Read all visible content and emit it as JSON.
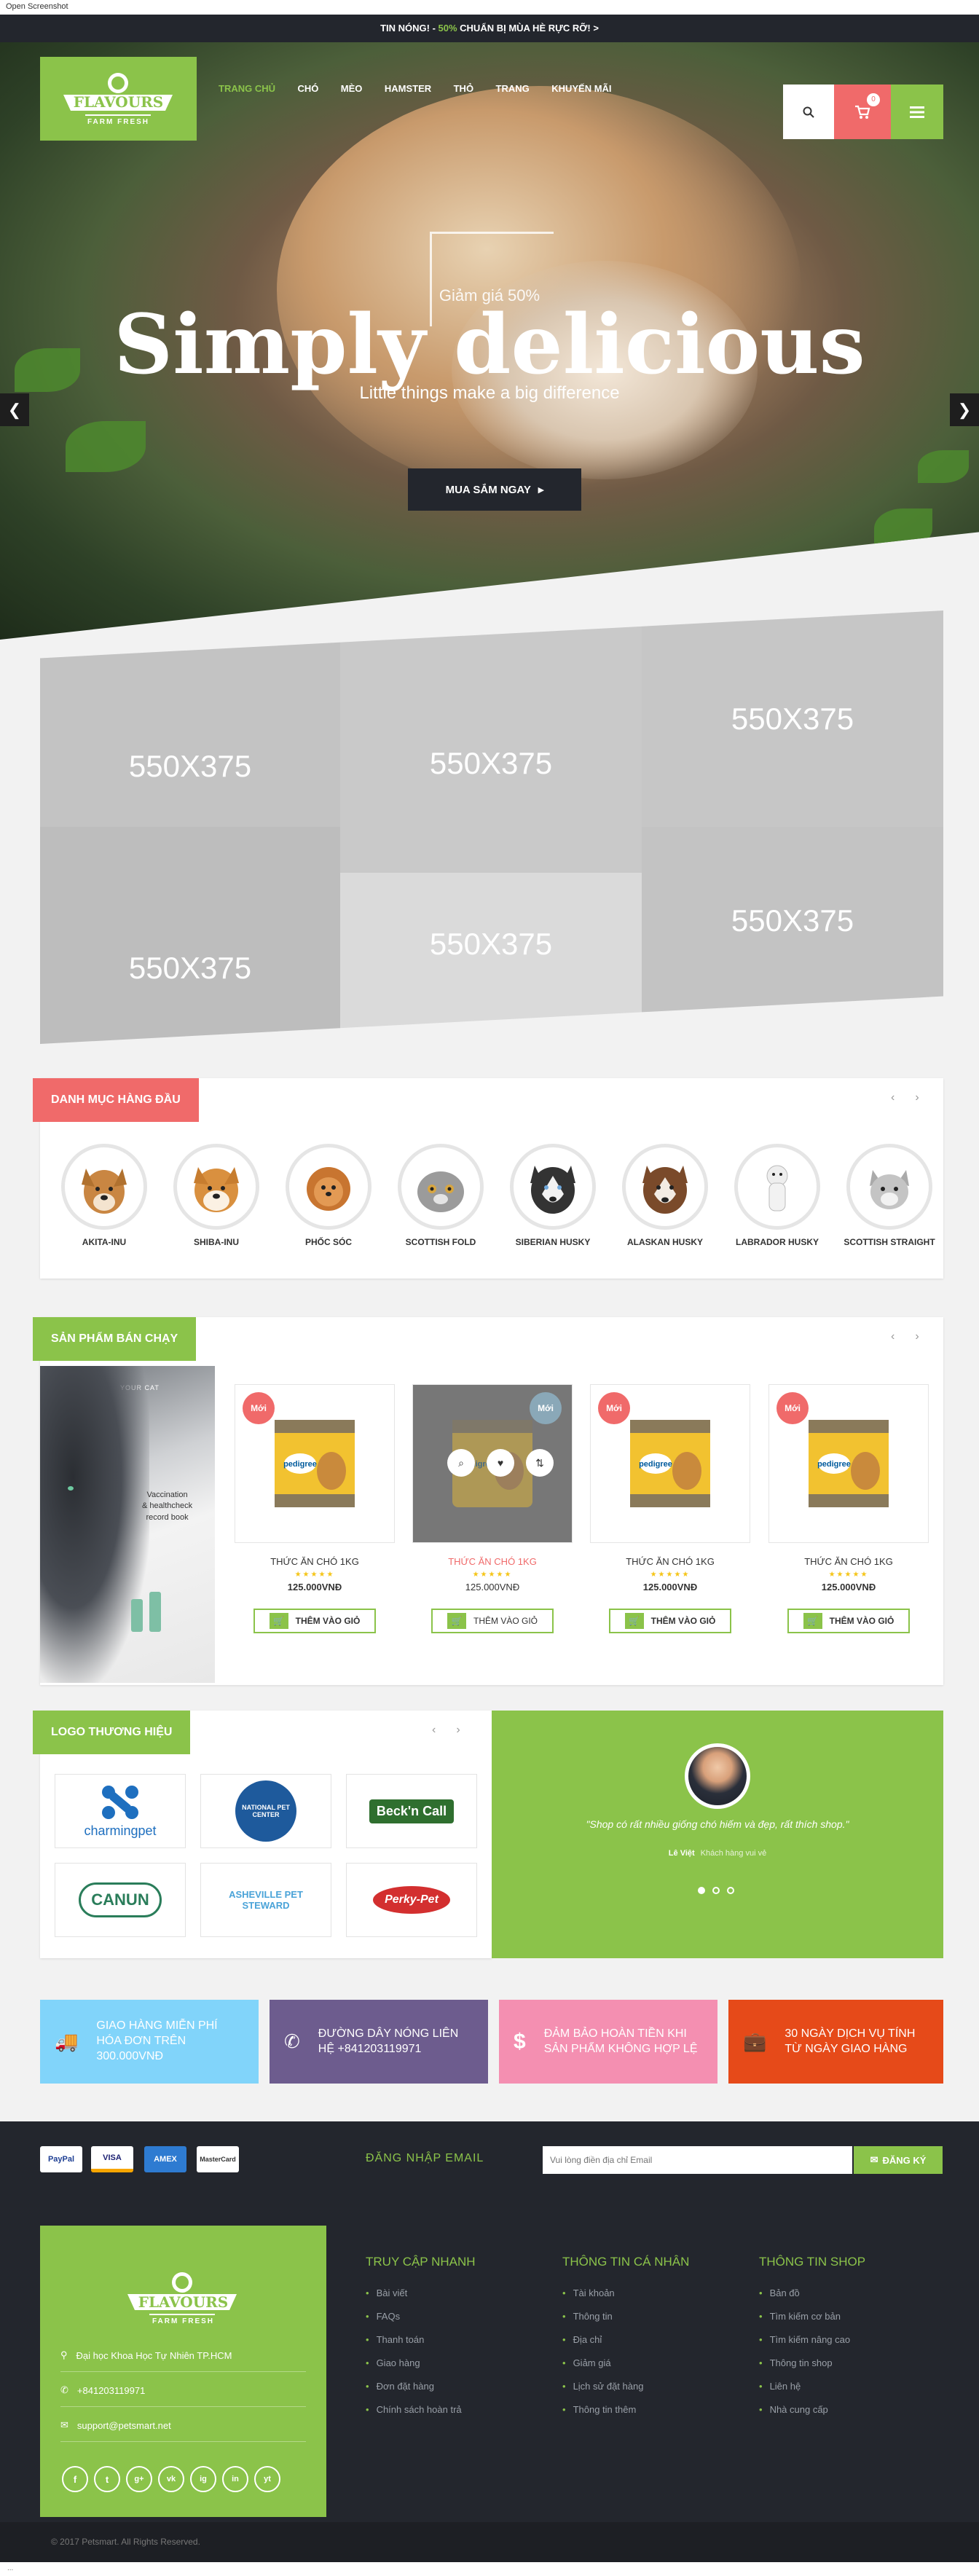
{
  "browser": {
    "label": "Open Screenshot",
    "status": "..."
  },
  "announcement": {
    "prefix": "TIN NÓNG! - ",
    "highlight": "50%",
    "suffix": " CHUẨN BỊ MÙA HÈ RỰC RỠ! >"
  },
  "logo": {
    "name": "FLAVOURS",
    "tagline": "FARM FRESH"
  },
  "nav": [
    "TRANG CHỦ",
    "CHÓ",
    "MÈO",
    "HAMSTER",
    "THỎ",
    "TRANG",
    "KHUYẾN MÃI"
  ],
  "cart": {
    "count": "0"
  },
  "hero": {
    "subtitle": "Giảm giá 50%",
    "title": "Simply delicious",
    "tagline": "Little things make a big difference",
    "cta": "MUA SẮM NGAY",
    "prev": "❮",
    "next": "❯"
  },
  "banners": [
    "550X375",
    "550X375",
    "550X375",
    "550X375",
    "550X375",
    "550X375"
  ],
  "categories": {
    "title": "DANH MỤC HÀNG ĐẦU",
    "prev": "‹",
    "next": "›",
    "items": [
      "AKITA-INU",
      "SHIBA-INU",
      "PHỐC SÓC",
      "SCOTTISH FOLD",
      "SIBERIAN HUSKY",
      "ALASKAN HUSKY",
      "LABRADOR HUSKY",
      "SCOTTISH STRAIGHT"
    ]
  },
  "bestsellers": {
    "title": "SẢN PHẨM BÁN CHẠY",
    "prev": "‹",
    "next": "›",
    "side_image_text": [
      "Vaccination",
      "& healthcheck",
      "record book"
    ],
    "side_image_header": "YOUR CAT",
    "products": [
      {
        "badge": "Mới",
        "name": "THỨC ĂN CHÓ 1KG",
        "price": "125.000VNĐ",
        "button": "THÊM VÀO GIỎ",
        "brand": "pedigree"
      },
      {
        "badge": "Mới",
        "name": "THỨC ĂN CHÓ 1KG",
        "price": "125.000VNĐ",
        "button": "THÊM VÀO GIỎ",
        "brand": "pedigree"
      },
      {
        "badge": "Mới",
        "name": "THỨC ĂN CHÓ 1KG",
        "price": "125.000VNĐ",
        "button": "THÊM VÀO GIỎ",
        "brand": "pedigree"
      },
      {
        "badge": "Mới",
        "name": "THỨC ĂN CHÓ 1KG",
        "price": "125.000VNĐ",
        "button": "THÊM VÀO GIỎ",
        "brand": "pedigree"
      }
    ],
    "rating": "★★★★★"
  },
  "brands": {
    "title": "LOGO THƯƠNG HIỆU",
    "prev": "‹",
    "next": "›",
    "items": [
      "charmingpet",
      "NATIONAL PET CENTER",
      "Beck'n Call",
      "CANUN",
      "ASHEVILLE PET STEWARD",
      "Perky-Pet"
    ]
  },
  "testimonial": {
    "quote": "\"Shop có rất nhiều giống chó hiếm và đẹp, rất thích shop.\"",
    "author": "Lê Việt",
    "role": "Khách hàng vui vẻ"
  },
  "services": [
    {
      "text": "GIAO HÀNG MIỄN PHÍ HÓA ĐƠN TRÊN 300.000VNĐ",
      "color": "#81d4fa",
      "icon": "truck-icon"
    },
    {
      "text": "ĐƯỜNG DÂY NÓNG LIÊN HỆ +841203119971",
      "color": "#6d5c8e",
      "icon": "phone-icon"
    },
    {
      "text": "ĐẢM BẢO HOÀN TIỀN KHI SẢN PHẨM KHÔNG HỢP LỆ",
      "color": "#f48fb1",
      "icon": "dollar-icon"
    },
    {
      "text": "30 NGÀY DỊCH VỤ TÍNH TỪ NGÀY GIAO HÀNG",
      "color": "#e64a19",
      "icon": "briefcase-icon"
    }
  ],
  "payments": [
    "PayPal",
    "VISA",
    "AMEX",
    "MasterCard"
  ],
  "newsletter": {
    "label": "ĐĂNG NHẬP EMAIL",
    "placeholder": "Vui lòng điền địa chỉ Email",
    "button": "ĐĂNG KÝ"
  },
  "footer": {
    "address": "Đại học Khoa Học Tự Nhiên TP.HCM",
    "phone": "+841203119971",
    "email": "support@petsmart.net",
    "social": [
      "f",
      "t",
      "g+",
      "vk",
      "ig",
      "in",
      "yt"
    ],
    "columns": [
      {
        "title": "TRUY CẬP NHANH",
        "items": [
          "Bài viết",
          "FAQs",
          "Thanh toán",
          "Giao hàng",
          "Đơn đặt hàng",
          "Chính sách hoàn trả"
        ]
      },
      {
        "title": "THÔNG TIN CÁ NHÂN",
        "items": [
          "Tài khoản",
          "Thông tin",
          "Địa chỉ",
          "Giảm giá",
          "Lịch sử đặt hàng",
          "Thông tin thêm"
        ]
      },
      {
        "title": "THÔNG TIN SHOP",
        "items": [
          "Bản đồ",
          "Tìm kiếm cơ bản",
          "Tìm kiếm nâng cao",
          "Thông tin shop",
          "Liên hệ",
          "Nhà cung cấp"
        ]
      }
    ],
    "copyright": "© 2017 Petsmart. All Rights Reserved."
  },
  "colors": {
    "accent": "#8bc34a",
    "red": "#f06a6a",
    "dark": "#23262d"
  }
}
